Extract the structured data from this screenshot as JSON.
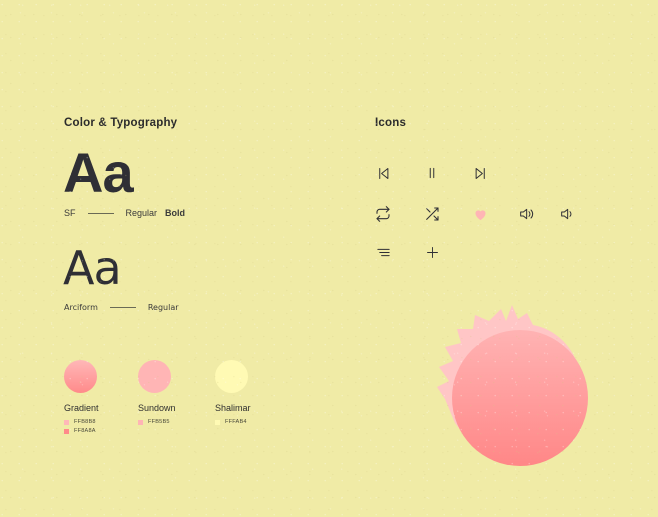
{
  "page": {
    "background_color": "#F0EBA6"
  },
  "sections": {
    "color_typography": {
      "title": "Color & Typography"
    },
    "icons": {
      "title": "Icons"
    }
  },
  "typography": [
    {
      "sample": "Aa",
      "family": "SF",
      "weights_regular": "Regular",
      "weights_bold": "Bold"
    },
    {
      "sample": "Aa",
      "family": "Arciform",
      "weights_regular": "Regular"
    }
  ],
  "colors": [
    {
      "name": "Gradient",
      "hex_values": [
        "FFB8B8",
        "FF8A8A"
      ]
    },
    {
      "name": "Sundown",
      "hex_values": [
        "FFB5B5"
      ]
    },
    {
      "name": "Shalimar",
      "hex_values": [
        "FFFAB4"
      ]
    }
  ],
  "icon_set": [
    {
      "name": "previous-track-icon"
    },
    {
      "name": "pause-icon"
    },
    {
      "name": "next-track-icon"
    },
    {
      "name": "repeat-icon"
    },
    {
      "name": "shuffle-icon"
    },
    {
      "name": "heart-icon",
      "color": "#FFB5B5"
    },
    {
      "name": "volume-high-icon"
    },
    {
      "name": "volume-low-icon"
    },
    {
      "name": "playlist-icon"
    },
    {
      "name": "plus-icon"
    }
  ],
  "artwork": {
    "name": "pink-gradient-blob",
    "circle_gradient_from": "#FFB0B0",
    "circle_gradient_to": "#FF8A8A",
    "backdrop_color": "#FFC4C4"
  }
}
